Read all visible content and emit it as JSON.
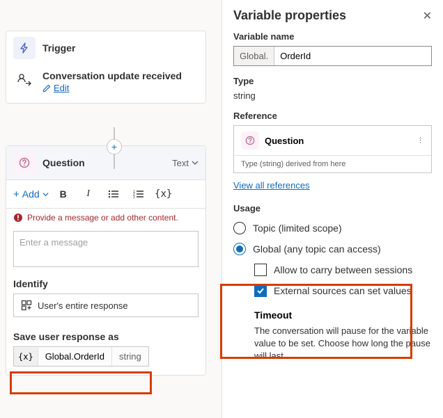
{
  "canvas": {
    "trigger": {
      "title": "Trigger",
      "conversation_title": "Conversation update received",
      "edit_label": "Edit"
    },
    "question": {
      "title": "Question",
      "type_label": "Text",
      "toolbar": {
        "add_label": "Add"
      },
      "error_message": "Provide a message or add other content.",
      "message_placeholder": "Enter a message",
      "identify_label": "Identify",
      "identify_value": "User's entire response",
      "save_label": "Save user response as",
      "variable_name": "Global.OrderId",
      "variable_type": "string"
    }
  },
  "panel": {
    "title": "Variable properties",
    "name_label": "Variable name",
    "name_prefix": "Global.",
    "name_value": "OrderId",
    "type_label": "Type",
    "type_value": "string",
    "reference_label": "Reference",
    "reference_title": "Question",
    "reference_sub": "Type (string) derived from here",
    "view_all_label": "View all references",
    "usage_label": "Usage",
    "usage_topic": "Topic (limited scope)",
    "usage_global": "Global (any topic can access)",
    "carry_sessions": "Allow to carry between sessions",
    "external_sources": "External sources can set values",
    "timeout_title": "Timeout",
    "timeout_text": "The conversation will pause for the variable value to be set. Choose how long the pause will last."
  }
}
